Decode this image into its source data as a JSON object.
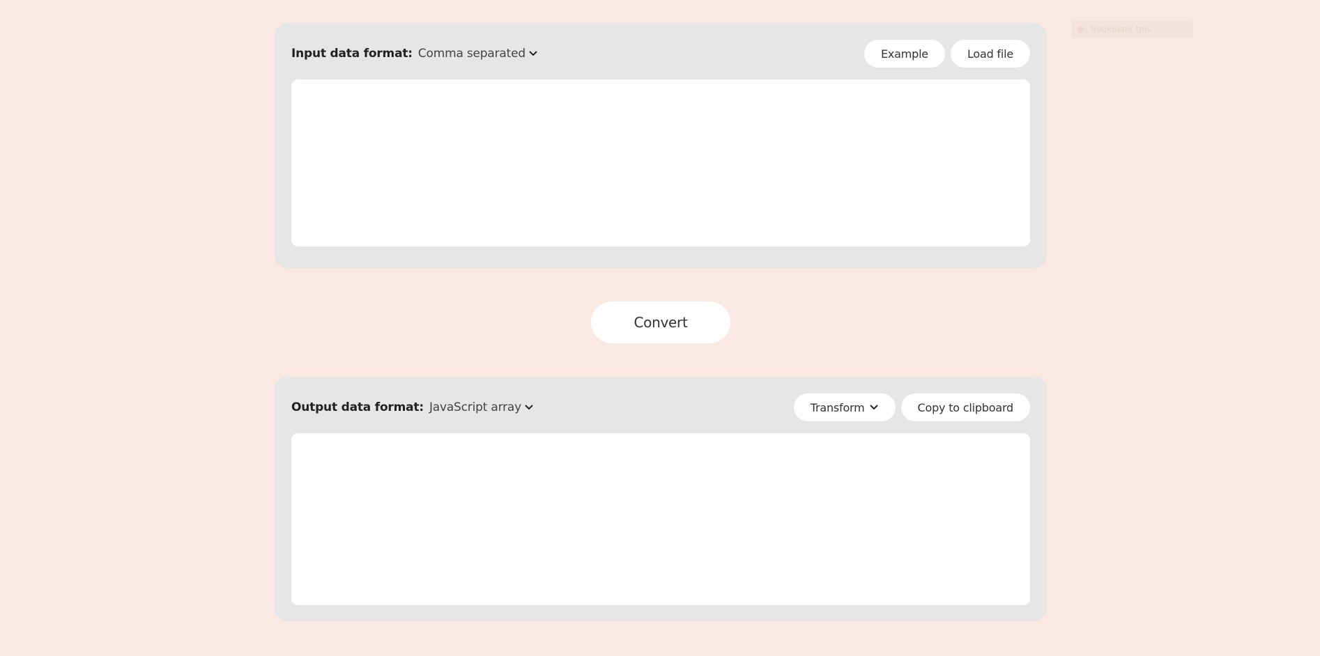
{
  "input_panel": {
    "format_label": "Input data format:",
    "format_value": "Comma separated",
    "example_button": "Example",
    "load_file_button": "Load file",
    "textarea_value": ""
  },
  "convert_button": "Convert",
  "output_panel": {
    "format_label": "Output data format:",
    "format_value": "JavaScript array",
    "transform_button": "Transform",
    "copy_button": "Copy to clipboard",
    "textarea_value": ""
  },
  "badge": {
    "label": "Bookmark this"
  },
  "colors": {
    "background": "#f9e9e2",
    "panel": "#e6e6e6",
    "field": "#ffffff"
  }
}
